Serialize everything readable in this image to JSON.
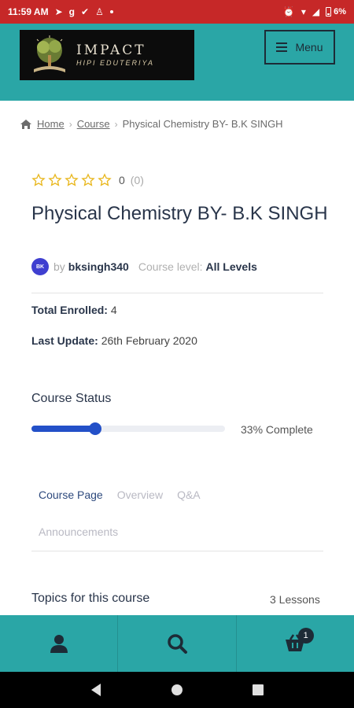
{
  "status_bar": {
    "time": "11:59 AM",
    "battery": "6%",
    "notif_icons": [
      "telegram-icon",
      "g-icon",
      "check-icon",
      "app-icon"
    ]
  },
  "header": {
    "logo_title": "IMPACT",
    "logo_subtitle": "HIPI EDUTERIYA",
    "menu_label": "Menu"
  },
  "breadcrumb": {
    "home": "Home",
    "course": "Course",
    "current": "Physical Chemistry BY- B.K SINGH"
  },
  "course": {
    "rating_stars_filled": 0,
    "rating_score": "0",
    "rating_count": "(0)",
    "title": "Physical Chemistry BY- B.K SINGH",
    "avatar_initials": "BK",
    "by_label": "by",
    "author": "bksingh340",
    "level_label": "Course level:",
    "level": "All Levels",
    "enrolled_label": "Total Enrolled:",
    "enrolled_value": "4",
    "updated_label": "Last Update:",
    "updated_value": "26th February 2020"
  },
  "status": {
    "title": "Course Status",
    "progress_fraction": 0.33,
    "progress_text": "33% Complete"
  },
  "tabs": {
    "items": [
      {
        "label": "Course Page",
        "active": true
      },
      {
        "label": "Overview",
        "active": false
      },
      {
        "label": "Q&A",
        "active": false
      }
    ],
    "second_row": "Announcements"
  },
  "topics": {
    "title": "Topics for this course",
    "count": "3 Lessons"
  },
  "bottom_nav": {
    "items": [
      "account-icon",
      "search-icon",
      "cart-icon"
    ],
    "cart_count": "1"
  },
  "colors": {
    "brand_teal": "#2aa6a6",
    "status_bar": "#c62828",
    "progress": "#2350c8",
    "heading": "#29354a"
  }
}
